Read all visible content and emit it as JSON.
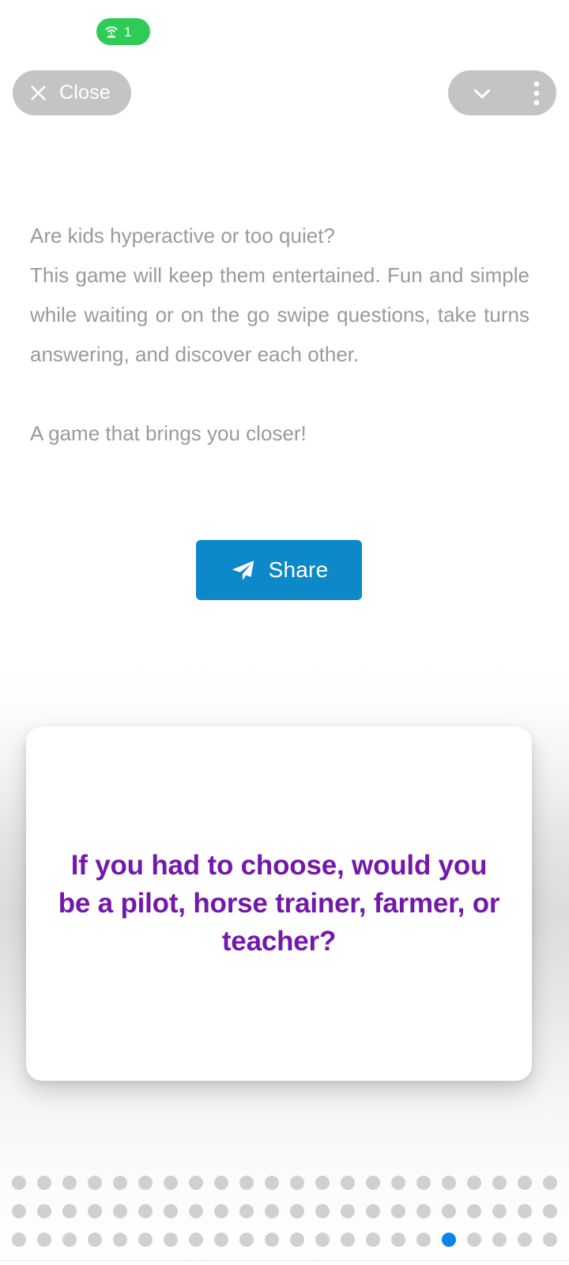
{
  "status": {
    "cast_badge": {
      "icon": "cast-screen-icon",
      "count": "1",
      "color": "#2ecc57"
    }
  },
  "topbar": {
    "close_label": "Close",
    "close_icon": "close-x-icon",
    "chevron_icon": "chevron-down-icon",
    "overflow_icon": "more-vertical-icon",
    "pill_color": "#c4c4c4"
  },
  "description": {
    "line1": "Are kids hyperactive or too quiet?",
    "line2": "This game will keep them entertained. Fun and simple while waiting or on the go swipe questions, take turns answering, and discover each other.",
    "line3": "A game that brings you closer!",
    "text_color": "#9a9a9a"
  },
  "share": {
    "label": "Share",
    "icon": "paper-plane-send-icon",
    "color": "#0d88c9"
  },
  "card": {
    "question": "If you had to choose, would you be a pilot, horse trainer, farmer, or teacher?",
    "text_color": "#7318ab",
    "background": "#ffffff"
  },
  "pagination": {
    "active_index": 17,
    "active_row": 2,
    "dot_color": "#d0d0d0",
    "active_color": "#0b84e8",
    "rows": [
      [
        "",
        "",
        "",
        "",
        "",
        "",
        "",
        "",
        "",
        "",
        "",
        "",
        "",
        "",
        "",
        "",
        "",
        "",
        "",
        "",
        "",
        ""
      ],
      [
        "",
        "",
        "",
        "",
        "",
        "",
        "",
        "",
        "",
        "",
        "",
        "",
        "",
        "",
        "",
        "",
        "",
        "",
        "",
        "",
        "",
        ""
      ],
      [
        "",
        "",
        "",
        "",
        "",
        "",
        "",
        "",
        "",
        "",
        "",
        "",
        "",
        "",
        "",
        "",
        "",
        "",
        "",
        "",
        "",
        ""
      ]
    ]
  }
}
